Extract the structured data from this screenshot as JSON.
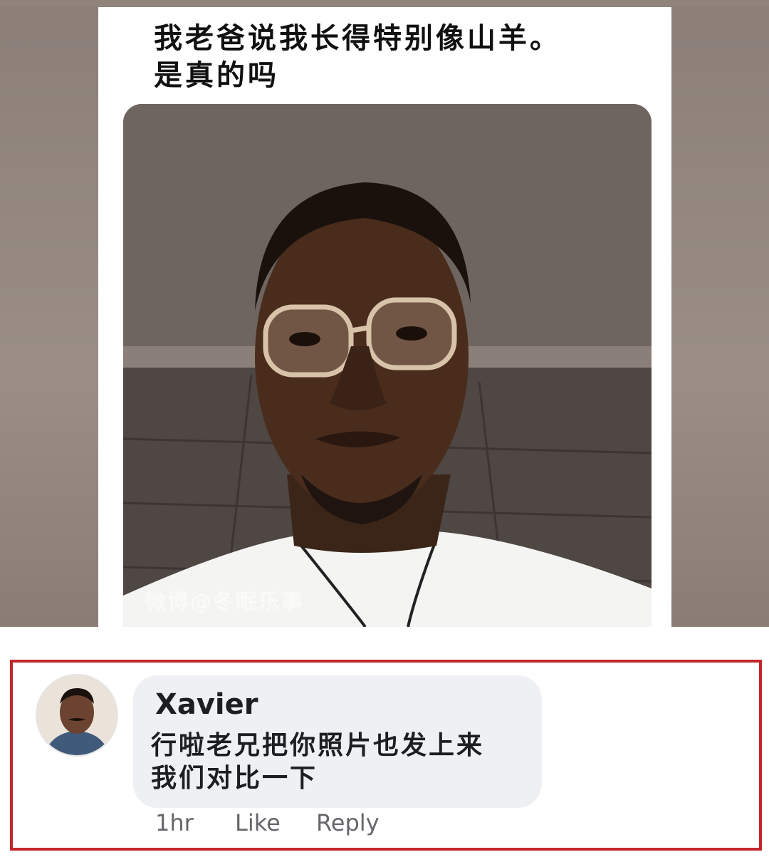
{
  "post": {
    "text_line1": "我老爸说我长得特别像山羊。",
    "text_line2": "是真的吗",
    "watermark": "微博@冬眠乐事"
  },
  "comment": {
    "author": "Xavier",
    "text_line1": "行啦老兄把你照片也发上来",
    "text_line2": "我们对比一下",
    "time": "1hr",
    "like_label": "Like",
    "reply_label": "Reply"
  },
  "colors": {
    "highlight_border": "#c3262b",
    "bubble_bg": "#eef0f3",
    "meta_text": "#65676b"
  }
}
